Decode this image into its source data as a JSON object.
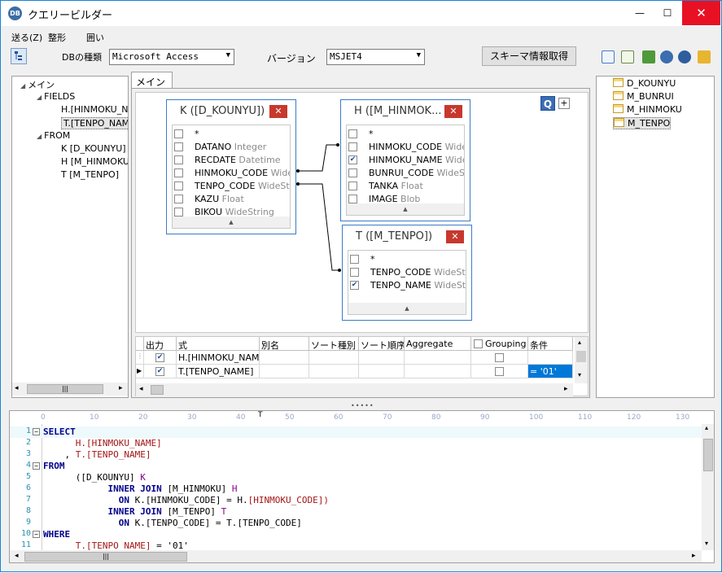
{
  "window": {
    "title": "クエリービルダー",
    "app_icon_text": "DB",
    "minimize": "—",
    "maximize": "☐",
    "close": "✕"
  },
  "menu": {
    "send": "送る(Z)",
    "format": "整形",
    "enclose": "囲い"
  },
  "toolbar": {
    "db_type_label": "DBの種類",
    "db_type_value": "Microsoft Access",
    "version_label": "バージョン",
    "version_value": "MSJET4",
    "schema_button": "スキーマ情報取得"
  },
  "left_tree": {
    "root": "メイン",
    "fields_label": "FIELDS",
    "fields": [
      "H.[HINMOKU_NAME]",
      "T.[TENPO_NAME]"
    ],
    "from_label": "FROM",
    "from": [
      "K [D_KOUNYU]",
      "H [M_HINMOKU]",
      "T [M_TENPO]"
    ]
  },
  "tab": {
    "label": "メイン"
  },
  "canvas": {
    "q_button": "Q",
    "plus_button": "+"
  },
  "tables": [
    {
      "title": "K ([D_KOUNYU])",
      "fields": [
        {
          "name": "*",
          "type": "",
          "checked": false
        },
        {
          "name": "DATANO",
          "type": "Integer",
          "checked": false
        },
        {
          "name": "RECDATE",
          "type": "Datetime",
          "checked": false
        },
        {
          "name": "HINMOKU_CODE",
          "type": "WideSt",
          "checked": false
        },
        {
          "name": "TENPO_CODE",
          "type": "WideString",
          "checked": false
        },
        {
          "name": "KAZU",
          "type": "Float",
          "checked": false
        },
        {
          "name": "BIKOU",
          "type": "WideString",
          "checked": false
        }
      ]
    },
    {
      "title": "H ([M_HINMOK...",
      "fields": [
        {
          "name": "*",
          "type": "",
          "checked": false
        },
        {
          "name": "HINMOKU_CODE",
          "type": "WideSt",
          "checked": false
        },
        {
          "name": "HINMOKU_NAME",
          "type": "WideSt",
          "checked": true
        },
        {
          "name": "BUNRUI_CODE",
          "type": "WideStrin",
          "checked": false
        },
        {
          "name": "TANKA",
          "type": "Float",
          "checked": false
        },
        {
          "name": "IMAGE",
          "type": "Blob",
          "checked": false
        }
      ]
    },
    {
      "title": "T ([M_TENPO])",
      "fields": [
        {
          "name": "*",
          "type": "",
          "checked": false
        },
        {
          "name": "TENPO_CODE",
          "type": "WideStrin",
          "checked": false
        },
        {
          "name": "TENPO_NAME",
          "type": "WideStrin",
          "checked": true
        }
      ]
    }
  ],
  "grid": {
    "headers": [
      "出力",
      "式",
      "別名",
      "ソート種別",
      "ソート順序",
      "Aggregate",
      "Grouping",
      "条件"
    ],
    "rows": [
      {
        "expr": "H.[HINMOKU_NAME]",
        "condition": ""
      },
      {
        "expr": "T.[TENPO_NAME]",
        "condition": "= '01'"
      }
    ]
  },
  "right_tables": [
    "D_KOUNYU",
    "M_BUNRUI",
    "M_HINMOKU",
    "M_TENPO"
  ],
  "splitter": "•••••",
  "ruler": [
    "0",
    "10",
    "20",
    "30",
    "40",
    "50",
    "60",
    "70",
    "80",
    "90",
    "100",
    "110",
    "120",
    "130"
  ],
  "sql_lines": [
    {
      "n": "1",
      "fold": "⊟",
      "parts": [
        [
          "kw",
          "SELECT"
        ]
      ]
    },
    {
      "n": "2",
      "fold": "",
      "parts": [
        [
          "",
          "      "
        ],
        [
          "id",
          "H.[HINMOKU_NAME]"
        ]
      ]
    },
    {
      "n": "3",
      "fold": "",
      "parts": [
        [
          "",
          "    , "
        ],
        [
          "id",
          "T.[TENPO_NAME]"
        ]
      ]
    },
    {
      "n": "4",
      "fold": "⊟",
      "parts": [
        [
          "kw",
          "FROM"
        ]
      ]
    },
    {
      "n": "5",
      "fold": "",
      "parts": [
        [
          "",
          "      ([D_KOUNYU] "
        ],
        [
          "al",
          "K"
        ]
      ]
    },
    {
      "n": "6",
      "fold": "",
      "parts": [
        [
          "",
          "            "
        ],
        [
          "kw",
          "INNER JOIN"
        ],
        [
          "",
          " [M_HINMOKU] "
        ],
        [
          "al",
          "H"
        ]
      ]
    },
    {
      "n": "7",
      "fold": "",
      "parts": [
        [
          "",
          "              "
        ],
        [
          "kw",
          "ON"
        ],
        [
          "",
          " K.[HINMOKU_CODE] = H."
        ],
        [
          "id",
          "[HINMOKU_CODE])"
        ]
      ]
    },
    {
      "n": "8",
      "fold": "",
      "parts": [
        [
          "",
          "            "
        ],
        [
          "kw",
          "INNER JOIN"
        ],
        [
          "",
          " [M_TENPO] "
        ],
        [
          "al",
          "T"
        ]
      ]
    },
    {
      "n": "9",
      "fold": "",
      "parts": [
        [
          "",
          "              "
        ],
        [
          "kw",
          "ON"
        ],
        [
          "",
          " K.[TENPO_CODE] = T.[TENPO_CODE]"
        ]
      ]
    },
    {
      "n": "10",
      "fold": "⊟",
      "parts": [
        [
          "kw",
          "WHERE"
        ]
      ]
    },
    {
      "n": "11",
      "fold": "",
      "parts": [
        [
          "",
          "      "
        ],
        [
          "id",
          "T.[TENPO_NAME]"
        ],
        [
          "",
          " = '01'"
        ]
      ]
    }
  ]
}
